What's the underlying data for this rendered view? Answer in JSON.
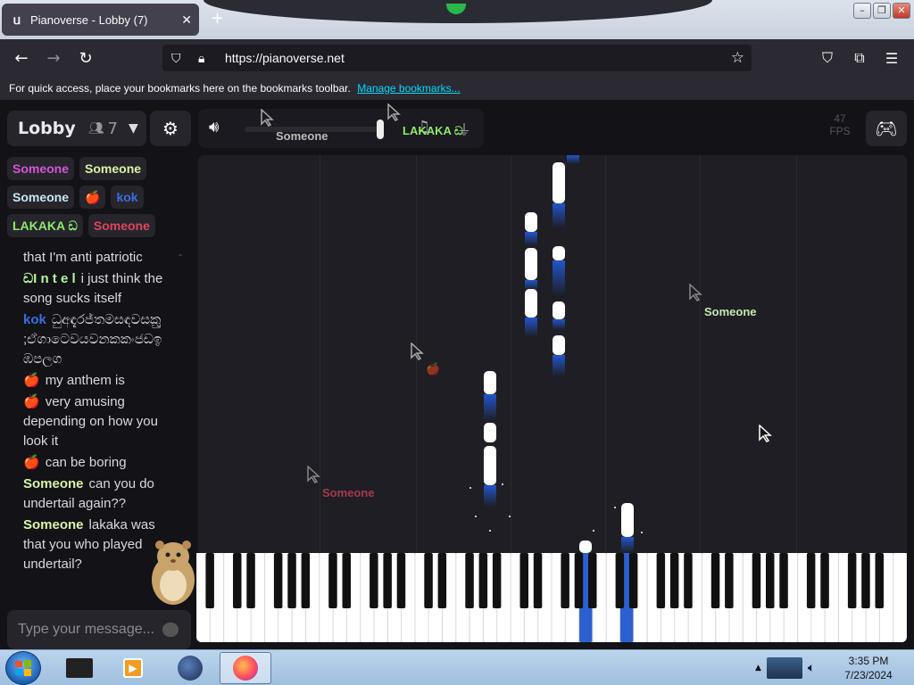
{
  "browser": {
    "tab_title": "Pianoverse - Lobby (7)",
    "tab_close": "✕",
    "new_tab": "+",
    "url": "https://pianoverse.net",
    "bookmarks_message": "For quick access, place your bookmarks here on the bookmarks toolbar.",
    "bookmarks_link": "Manage bookmarks..."
  },
  "lobby": {
    "name": "Lobby",
    "user_count": "7"
  },
  "users": [
    {
      "name": "Someone",
      "color": "#d655d6"
    },
    {
      "name": "Someone",
      "color": "#d9f5a0"
    },
    {
      "name": "Someone",
      "color": "#c8e8f0"
    },
    {
      "name": "🍎",
      "color": "#e33"
    },
    {
      "name": "kok",
      "color": "#3a6de0"
    },
    {
      "name": "LAKAKA ඩ",
      "color": "#8ee86a"
    },
    {
      "name": "Someone",
      "color": "#e0445e"
    }
  ],
  "chat": {
    "placeholder": "Type your message...",
    "messages": [
      {
        "author": "",
        "text": "that I'm anti patriotic",
        "author_color": ""
      },
      {
        "author": "ඩI n t e l",
        "text": "i just think the song sucks itself",
        "author_color": "#b6f5a4"
      },
      {
        "author": "kok",
        "text": "ධුඅඳැරජ්තමසඳවසකුු ;ඒගාටෙවයවනකකංජඩඉ ඹපලග",
        "author_color": "#3a6de0"
      },
      {
        "author": "🍎",
        "text": "my anthem is",
        "author_color": "#e33"
      },
      {
        "author": "🍎",
        "text": "very amusing depending on how you look it",
        "author_color": "#e33"
      },
      {
        "author": "🍎",
        "text": "can be boring",
        "author_color": "#e33"
      },
      {
        "author": "Someone",
        "text": "can you do undertail again??",
        "author_color": "#d9f5a0"
      },
      {
        "author": "Someone",
        "text": "lakaka was that you who played undertail?",
        "author_color": "#d9f5a0"
      }
    ]
  },
  "stage": {
    "fps_value": "47",
    "fps_label": "FPS"
  },
  "cursors": [
    {
      "label": "Someone",
      "color": "#bbb"
    },
    {
      "label": "LAKAKA ඩ",
      "color": "#8ee86a"
    },
    {
      "label": "Someone",
      "color": "#c8e8b0"
    },
    {
      "label": "Someone",
      "color": "#e0445e"
    },
    {
      "label": "🍎",
      "color": "#e33"
    }
  ],
  "taskbar": {
    "time": "3:35 PM",
    "date": "7/23/2024"
  },
  "colors": {
    "accent_blue": "#2255cc",
    "page_bg": "#121217",
    "panel_bg": "#26252c"
  }
}
